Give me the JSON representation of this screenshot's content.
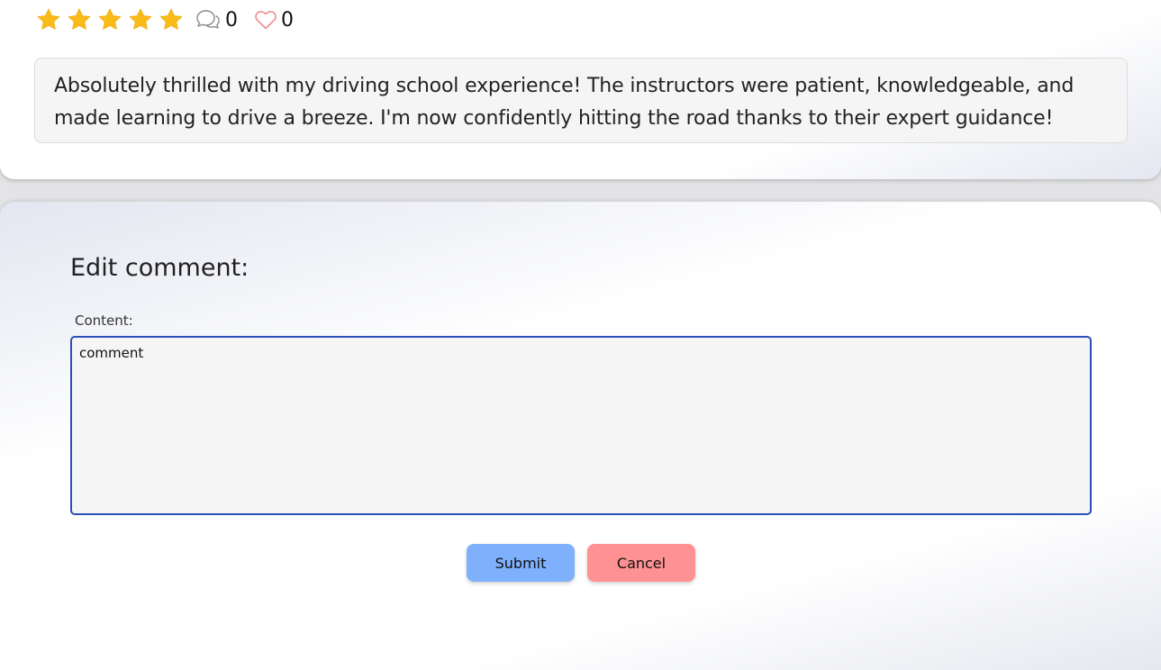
{
  "review": {
    "rating": 5,
    "rating_max": 5,
    "comment_count": "0",
    "like_count": "0",
    "text": "Absolutely thrilled with my driving school experience! The instructors were patient, knowledgeable, and made learning to drive a breeze. I'm now confidently hitting the road thanks to their expert guidance!",
    "icons": [
      "star-icon",
      "comment-icon",
      "heart-icon"
    ]
  },
  "edit_form": {
    "title": "Edit comment:",
    "content_label": "Content:",
    "content_value": "comment",
    "submit_label": "Submit",
    "cancel_label": "Cancel"
  },
  "colors": {
    "star": "#f9bb1a",
    "heart": "#f08a8a",
    "textarea_border": "#2a4fb8",
    "submit_button": "#7eb0fb",
    "cancel_button": "#fe9191"
  }
}
